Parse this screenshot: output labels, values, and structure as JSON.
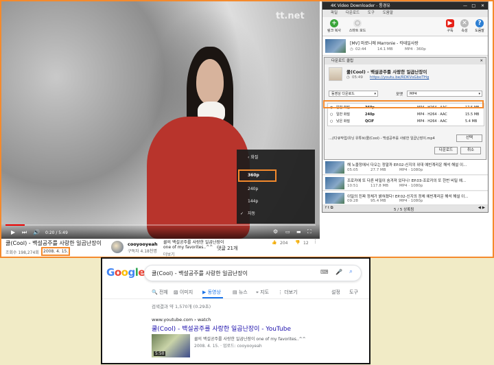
{
  "youtube": {
    "watermark": "tt.net",
    "time": "0:20 / 5:49",
    "settings_menu": {
      "header": "화질",
      "options": [
        "360p",
        "240p",
        "144p",
        "자동"
      ],
      "selected": "360p"
    },
    "video_title": "쿨(Cool) - 백설공주를 사랑한 일곱난장이",
    "views": "조회수 198,274회",
    "date": "2008. 4. 15.",
    "channel_name": "cooyooyeah",
    "subscribers": "구독자 4.18천명",
    "description_line1": "쿨의 백설공주를 사랑한 일곱난장이",
    "description_line2": "one of my favorites..^^",
    "comments_label": "댓글 21개",
    "more": "더보기",
    "likes": "204",
    "dislikes": "12"
  },
  "downloader": {
    "title": "4K Video Downloader - 통경유",
    "menu": [
      "파일",
      "다운로드",
      "도구",
      "도움말"
    ],
    "toolbar": {
      "paste_link": "링크 복사",
      "smart_mode": "스마트 모드",
      "subscribe": "구독",
      "settings": "속성",
      "help": "도움말"
    },
    "top_item": {
      "title": "[MV] 마로니에 Marronie - 칵테일사랑",
      "duration": "02:44",
      "size": "14.1 MB",
      "format": "MP4 · 360p"
    },
    "dialog": {
      "title": "다운로드 클립",
      "clip_title": "쿨(Cool) - 백설공주를 사랑한 일곱난장이",
      "duration": "05:49",
      "url": "https://youtu.be/RDKVsGboTHg",
      "mode_select": "동영상 다운로드",
      "format_label": "포맷",
      "format_select": "MP4",
      "qualities": [
        {
          "name": "일반 화질",
          "res": "360p",
          "codec": "MP4 · H264 · AAC",
          "size": "17.5 MB",
          "checked": true
        },
        {
          "name": "일반 화질",
          "res": "240p",
          "codec": "MP4 · H264 · AAC",
          "size": "15.5 MB",
          "checked": false
        },
        {
          "name": "낮은 화질",
          "res": "QCIF",
          "codec": "MP4 · H264 · AAC",
          "size": "5.4 MB",
          "checked": false
        }
      ],
      "save_path": "...//다큐작업/유닝 유튜브/쿨(Cool) - 백설공주를 사랑한 일곱난장이.mp4",
      "browse_button": "선택",
      "download_button": "다운로드",
      "cancel_button": "취소"
    },
    "list": [
      {
        "title": "해 노을정에서 다오는 정말까   EP.02-신지의 위대   예빈계리운 해석 해설 이...",
        "duration": "05:05",
        "size": "27.7 MB",
        "format": "MP4 · 1080p"
      },
      {
        "title": "조로카에 또 다른 비밀이 숨겨져 있더니! EP.03-조로카의 또 한번 비밀   예...",
        "duration": "10:51",
        "size": "117.8 MB",
        "format": "MP4 · 1080p"
      },
      {
        "title": "이밀의 진짜 정체가 밝혀졌다!  EP.02-신지의 정체   예빈계리운 해석 해설 이...",
        "duration": "09:28",
        "size": "95.4 MB",
        "format": "MP4 · 1080p"
      }
    ],
    "status": "5 / 5 상록됨"
  },
  "google": {
    "query": "쿨(Cool) - 백설공주를 사랑한 일곱난장이",
    "tabs": [
      "전체",
      "이미지",
      "동영상",
      "뉴스",
      "지도",
      "더보기"
    ],
    "active_tab": "동영상",
    "settings": "설정",
    "tools": "도구",
    "results_count": "검색결과 약 1,570개 (0.29초)",
    "result": {
      "url": "www.youtube.com › watch",
      "title": "쿨(Cool) - 백설공주를 사랑한 일곱난장이 - YouTube",
      "snippet": "쿨의 백설공주를 사랑한 일곱난장이 one of my favorites..^^",
      "meta": "2008. 4. 15. · 업로드: cooyooyeah",
      "duration": "5:50"
    },
    "colors": {
      "blue": "#4285f4",
      "red": "#ea4335",
      "yellow": "#fbbc05",
      "green": "#34a853",
      "link": "#1a0dab"
    }
  },
  "annotation_color": "#f58a2c"
}
